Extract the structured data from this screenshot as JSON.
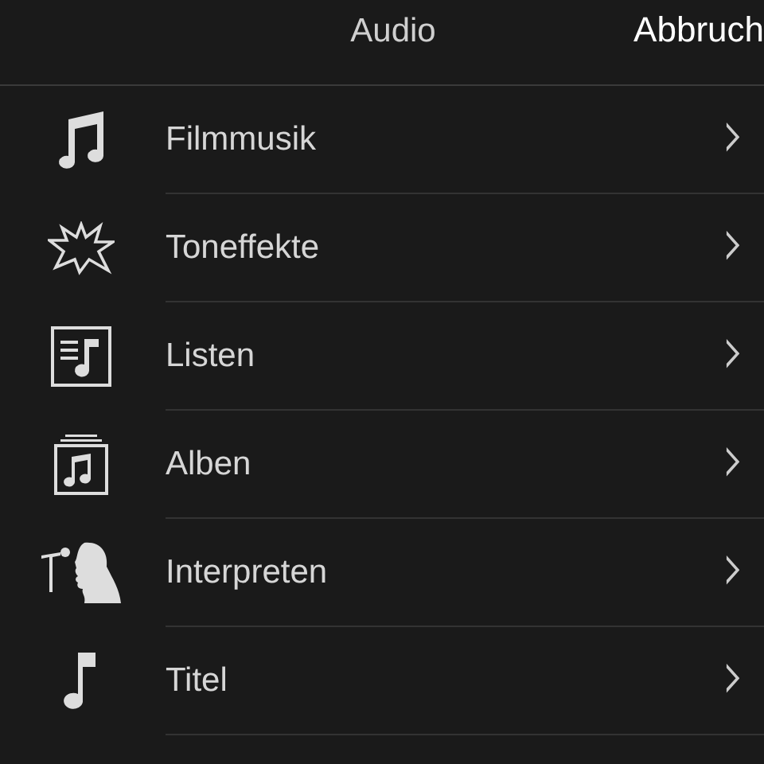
{
  "header": {
    "title": "Audio",
    "cancel": "Abbruch"
  },
  "items": [
    {
      "kind": "music",
      "label": "Filmmusik",
      "chevron": "›"
    },
    {
      "kind": "effects",
      "label": "Toneffekte",
      "chevron": "›"
    },
    {
      "kind": "playlists",
      "label": "Listen",
      "chevron": "›"
    },
    {
      "kind": "albums",
      "label": "Alben",
      "chevron": "›"
    },
    {
      "kind": "artists",
      "label": "Interpreten",
      "chevron": "›"
    },
    {
      "kind": "songs",
      "label": "Titel",
      "chevron": "›"
    }
  ]
}
